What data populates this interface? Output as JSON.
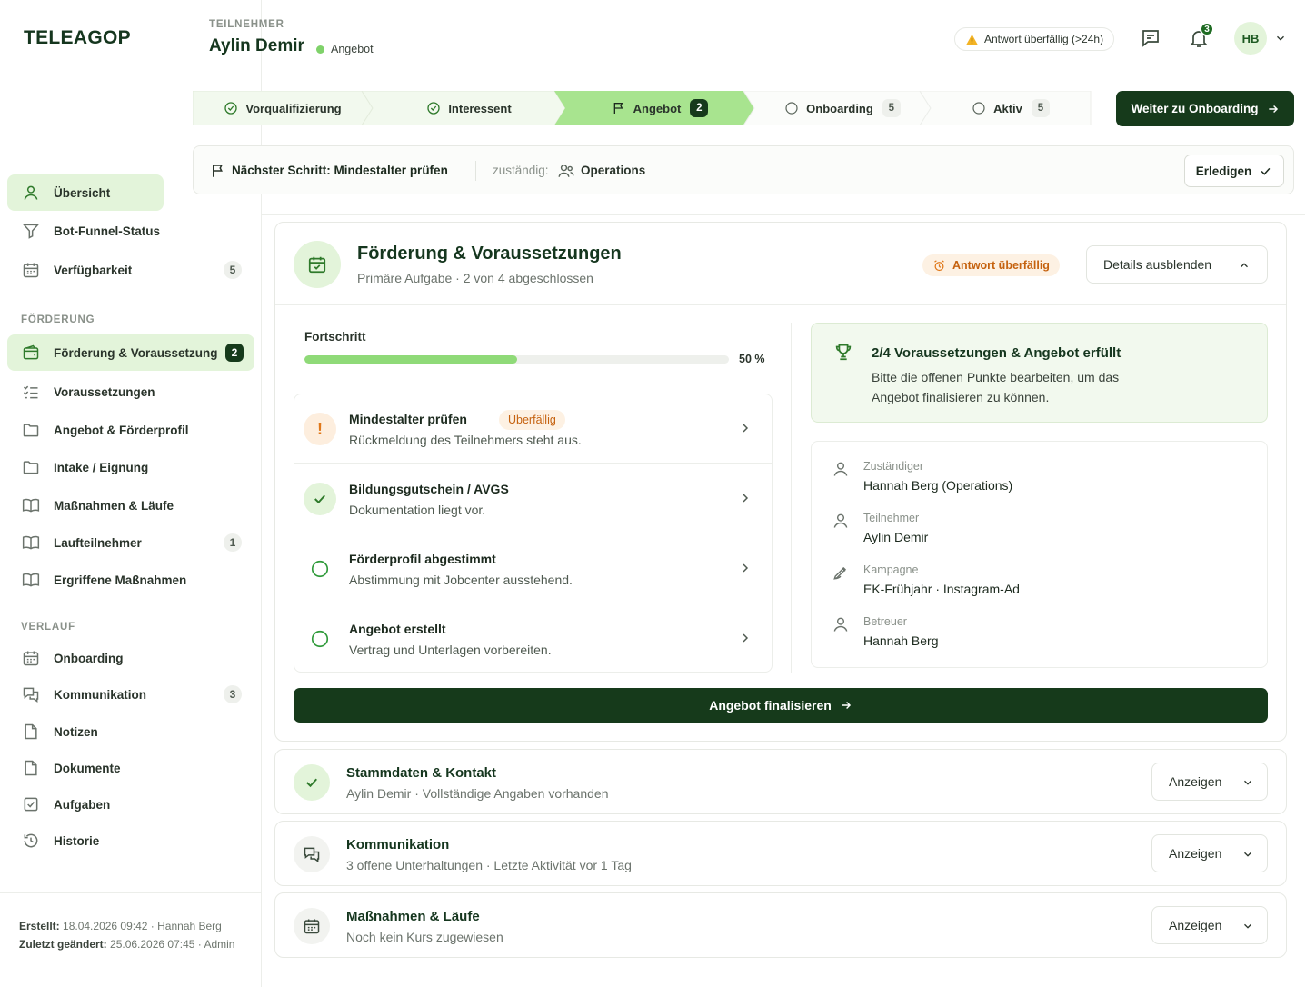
{
  "app": {
    "logo": "TELEAGOP"
  },
  "header": {
    "kicker": "TEILNEHMER",
    "name": "Aylin Demir",
    "status": "Angebot",
    "warning": "Antwort überfällig (>24h)",
    "notifications_count": "3",
    "avatar_initials": "HB"
  },
  "sidebar": {
    "items_top": [
      {
        "label": "Übersicht",
        "icon": "user-icon",
        "active": true
      },
      {
        "label": "Bot-Funnel-Status",
        "icon": "filter-icon"
      },
      {
        "label": "Verfügbarkeit",
        "icon": "calendar-icon",
        "badge": "5"
      }
    ],
    "section_foerderung": "FÖRDERUNG",
    "items_foerderung": [
      {
        "label": "Förderung & Voraussetzung",
        "icon": "wallet-icon",
        "badge": "2",
        "active": true
      },
      {
        "label": "Voraussetzungen",
        "icon": "checklist-icon"
      },
      {
        "label": "Angebot & Förderprofil",
        "icon": "folder-icon"
      },
      {
        "label": "Intake / Eignung",
        "icon": "folder-icon"
      },
      {
        "label": "Maßnahmen & Läufe",
        "icon": "book-icon"
      },
      {
        "label": "Laufteilnehmer",
        "icon": "book-icon",
        "badge": "1"
      },
      {
        "label": "Ergriffene Maßnahmen",
        "icon": "book-icon"
      }
    ],
    "section_verlauf": "VERLAUF",
    "items_verlauf": [
      {
        "label": "Onboarding",
        "icon": "calendar-icon"
      },
      {
        "label": "Kommunikation",
        "icon": "chat-icon",
        "badge": "3"
      },
      {
        "label": "Notizen",
        "icon": "file-icon"
      },
      {
        "label": "Dokumente",
        "icon": "file-icon"
      },
      {
        "label": "Aufgaben",
        "icon": "task-icon"
      },
      {
        "label": "Historie",
        "icon": "history-icon"
      }
    ],
    "footer": {
      "created_label": "Erstellt:",
      "created_value": "18.04.2026 09:42",
      "created_by": "Hannah Berg",
      "changed_label": "Zuletzt geändert:",
      "changed_value": "25.06.2026 07:45",
      "changed_by": "Admin"
    }
  },
  "stepper": {
    "steps": [
      {
        "label": "Vorqualifizierung",
        "state": "done"
      },
      {
        "label": "Interessent",
        "state": "done"
      },
      {
        "label": "Angebot",
        "state": "current",
        "badge": "2"
      },
      {
        "label": "Onboarding",
        "state": "open",
        "badge": "5"
      },
      {
        "label": "Aktiv",
        "state": "open",
        "badge": "5"
      }
    ],
    "next_button": "Weiter zu Onboarding"
  },
  "next_step": {
    "label": "Nächster Schritt:",
    "value": "Mindestalter prüfen",
    "responsible_label": "zuständig:",
    "responsible": "Operations",
    "done_button": "Erledigen"
  },
  "task": {
    "title": "Förderung & Voraussetzungen",
    "subtitle": "Primäre Aufgabe · 2 von 4 abgeschlossen",
    "overdue": "Antwort überfällig",
    "toggle_button": "Details ausblenden",
    "progress_label": "Fortschritt",
    "progress_value": 50,
    "progress_text": "50 %",
    "checklist": [
      {
        "title": "Mindestalter prüfen",
        "desc": "Rückmeldung des Teilnehmers steht aus.",
        "state": "warn",
        "tag": "Überfällig"
      },
      {
        "title": "Bildungsgutschein / AVGS",
        "desc": "Dokumentation liegt vor.",
        "state": "ok"
      },
      {
        "title": "Förderprofil abgestimmt",
        "desc": "Abstimmung mit Jobcenter ausstehend.",
        "state": "open"
      },
      {
        "title": "Angebot erstellt",
        "desc": "Vertrag und Unterlagen vorbereiten.",
        "state": "open"
      }
    ],
    "summary_title": "2/4 Voraussetzungen & Angebot erfüllt",
    "summary_text": "Bitte die offenen Punkte bearbeiten, um das Angebot finalisieren zu können.",
    "meta": [
      {
        "label": "Zuständiger",
        "value": "Hannah Berg (Operations)",
        "icon": "user-icon"
      },
      {
        "label": "Teilnehmer",
        "value": "Aylin Demir",
        "icon": "user-icon"
      },
      {
        "label": "Kampagne",
        "value": "EK-Frühjahr · Instagram-Ad",
        "icon": "pen-icon"
      },
      {
        "label": "Betreuer",
        "value": "Hannah Berg",
        "icon": "user-icon"
      }
    ],
    "finalize_button": "Angebot finalisieren"
  },
  "sections": [
    {
      "title": "Stammdaten & Kontakt",
      "sub": "Aylin Demir · Vollständige Angaben vorhanden",
      "icon": "check-icon",
      "button": "Anzeigen"
    },
    {
      "title": "Kommunikation",
      "sub": "3 offene Unterhaltungen · Letzte Aktivität vor 1 Tag",
      "icon": "chat-icon",
      "button": "Anzeigen"
    },
    {
      "title": "Maßnahmen & Läufe",
      "sub": "Noch kein Kurs zugewiesen",
      "icon": "calendar-icon",
      "button": "Anzeigen"
    }
  ],
  "colors": {
    "brand_dark": "#163a1b",
    "accent_light": "#e3f4da",
    "progress": "#8fda78",
    "warning": "#c5620f"
  }
}
